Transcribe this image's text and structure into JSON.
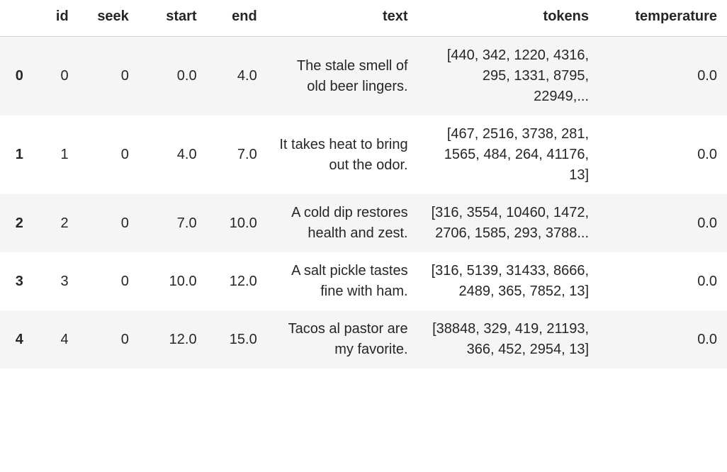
{
  "columns": {
    "index": "",
    "id": "id",
    "seek": "seek",
    "start": "start",
    "end": "end",
    "text": "text",
    "tokens": "tokens",
    "temperature": "temperature"
  },
  "rows": [
    {
      "index": "0",
      "id": "0",
      "seek": "0",
      "start": "0.0",
      "end": "4.0",
      "text": "The stale smell of old beer lingers.",
      "tokens": "[440, 342, 1220, 4316, 295, 1331, 8795, 22949,...",
      "temperature": "0.0"
    },
    {
      "index": "1",
      "id": "1",
      "seek": "0",
      "start": "4.0",
      "end": "7.0",
      "text": "It takes heat to bring out the odor.",
      "tokens": "[467, 2516, 3738, 281, 1565, 484, 264, 41176, 13]",
      "temperature": "0.0"
    },
    {
      "index": "2",
      "id": "2",
      "seek": "0",
      "start": "7.0",
      "end": "10.0",
      "text": "A cold dip restores health and zest.",
      "tokens": "[316, 3554, 10460, 1472, 2706, 1585, 293, 3788...",
      "temperature": "0.0"
    },
    {
      "index": "3",
      "id": "3",
      "seek": "0",
      "start": "10.0",
      "end": "12.0",
      "text": "A salt pickle tastes fine with ham.",
      "tokens": "[316, 5139, 31433, 8666, 2489, 365, 7852, 13]",
      "temperature": "0.0"
    },
    {
      "index": "4",
      "id": "4",
      "seek": "0",
      "start": "12.0",
      "end": "15.0",
      "text": "Tacos al pastor are my favorite.",
      "tokens": "[38848, 329, 419, 21193, 366, 452, 2954, 13]",
      "temperature": "0.0"
    }
  ]
}
